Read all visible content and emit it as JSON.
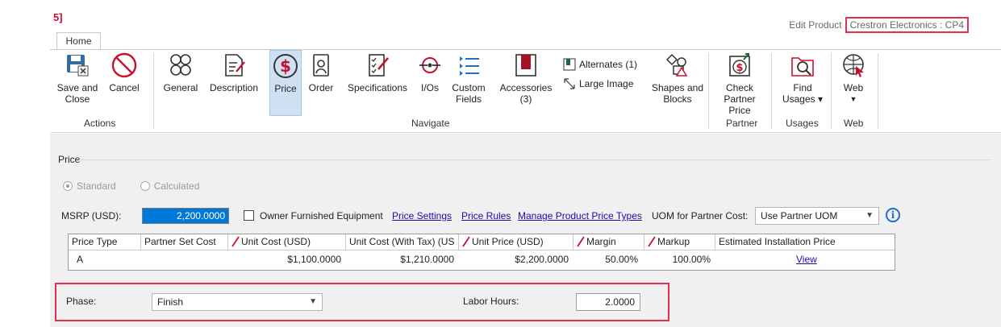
{
  "app": {
    "logo_text": "5]",
    "home_tab": "Home",
    "edit_label": "Edit Product",
    "product_name": "Crestron Electronics : CP4"
  },
  "ribbon": {
    "save_close": "Save and Close",
    "cancel": "Cancel",
    "actions_group": "Actions",
    "general": "General",
    "description": "Description",
    "price": "Price",
    "order": "Order",
    "specifications": "Specifications",
    "ios": "I/Os",
    "custom_fields": "Custom Fields",
    "accessories": "Accessories (3)",
    "alternates": "Alternates (1)",
    "large_image": "Large Image",
    "navigate_group": "Navigate",
    "shapes_blocks": "Shapes and Blocks",
    "check_partner_price": "Check Partner Price",
    "partner_group": "Partner",
    "find_usages": "Find Usages ▾",
    "usages_group": "Usages",
    "web": "Web",
    "web_group": "Web"
  },
  "price_section": {
    "title": "Price",
    "radio_standard": "Standard",
    "radio_calculated": "Calculated",
    "msrp_label": "MSRP (USD):",
    "msrp_value": "2,200.0000",
    "owner_furnished": "Owner Furnished Equipment",
    "price_settings": "Price Settings",
    "price_rules": "Price Rules",
    "manage_types": "Manage Product Price Types",
    "uom_label": "UOM for Partner Cost:",
    "uom_value": "Use Partner UOM"
  },
  "grid": {
    "headers": [
      "Price Type",
      "Partner Set Cost",
      "Unit Cost (USD)",
      "Unit Cost (With Tax) (US",
      "Unit Price (USD)",
      "Margin",
      "Markup",
      "Estimated Installation Price"
    ],
    "row": [
      "A",
      "",
      "$1,100.0000",
      "$1,210.0000",
      "$2,200.0000",
      "50.00%",
      "100.00%",
      "View"
    ]
  },
  "phase": {
    "label": "Phase:",
    "value": "Finish",
    "labor_label": "Labor Hours:",
    "labor_value": "2.0000"
  },
  "colors": {
    "accent_red": "#e0314b",
    "link_blue": "#1a0dab",
    "selected_blue": "#cfe0f3"
  }
}
